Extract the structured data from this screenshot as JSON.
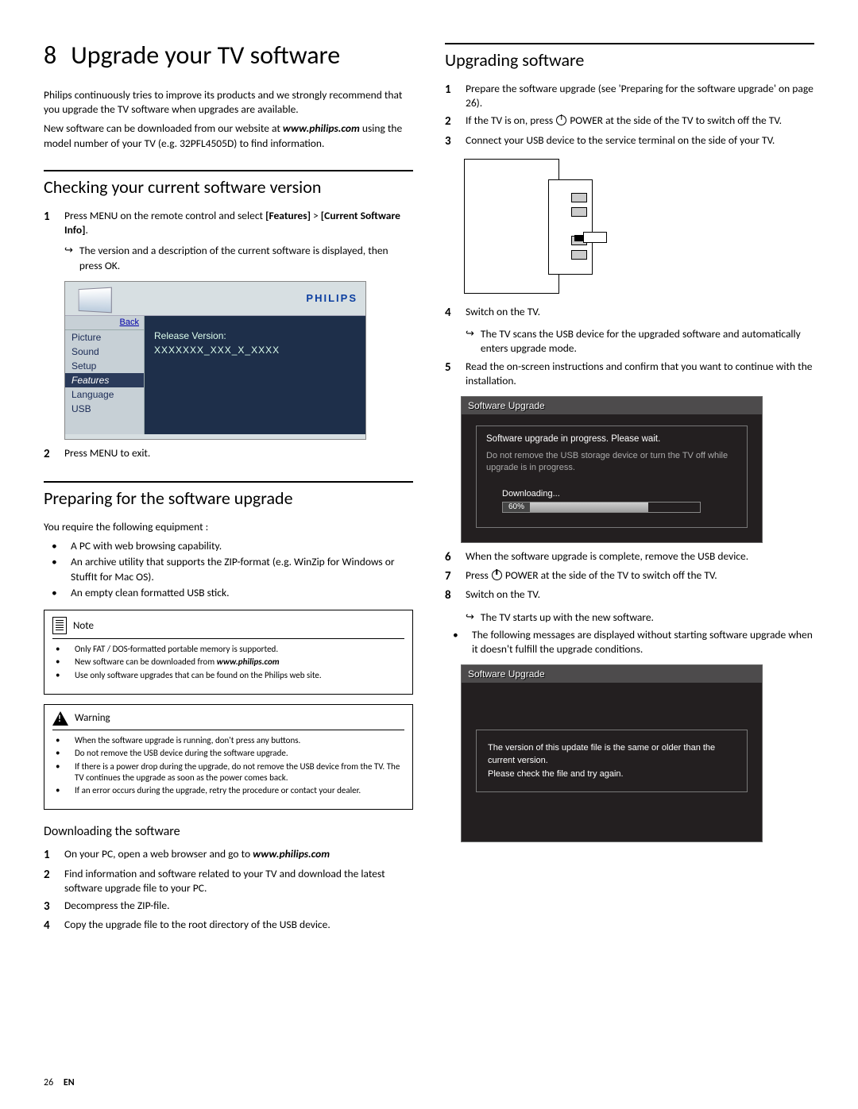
{
  "chapter": {
    "number": "8",
    "title": "Upgrade your TV software"
  },
  "intro1": "Philips continuously tries to improve its products and we strongly recommend that you upgrade the TV software when upgrades are available.",
  "intro2a": "New software can be downloaded from our website at ",
  "intro2_site": "www.philips.com",
  "intro2b": " using the model number of your TV (e.g. 32PFL4505D) to find information.",
  "section_check": "Checking your current software version",
  "check_step1a": "Press MENU on the remote control and select ",
  "check_step1b": "[Features]",
  "check_step1c": " > ",
  "check_step1d": "[Current Software Info]",
  "check_step1e": ".",
  "check_sub1": "The version and a description of the current software is displayed, then press OK.",
  "tv_logo": "PHILIPS",
  "tv_back": "Back",
  "tv_menu": [
    "Picture",
    "Sound",
    "Setup",
    "Features",
    "Language",
    "USB"
  ],
  "tv_release1": "Release Version:",
  "tv_release2": "XXXXXXX_XXX_X_XXXX",
  "check_step2": "Press MENU to exit.",
  "section_prepare": "Preparing for the software upgrade",
  "prepare_intro": "You require the following equipment :",
  "prepare_bullets": [
    "A PC with web browsing capability.",
    "An archive utility that supports the ZIP-format (e.g. WinZip for Windows or StuffIt for Mac OS).",
    "An empty clean formatted USB stick."
  ],
  "note_label": "Note",
  "note_items_a": "Only FAT / DOS-formatted portable memory is supported.",
  "note_items_b_pre": "New software can be downloaded from ",
  "note_items_b_site": "www.philips.com",
  "note_items_c": "Use only software upgrades that can be found on the Philips web site.",
  "warn_label": "Warning",
  "warn_items": [
    "When the software upgrade is running, don't press any buttons.",
    "Do not remove the USB device during the software upgrade.",
    "If there is a power drop during the upgrade, do not remove the USB device from the TV. The TV continues the upgrade as soon as the power comes back.",
    "If an error occurs during the upgrade, retry the procedure or contact your dealer."
  ],
  "subsection_download": "Downloading the software",
  "dl_step1a": "On your PC, open a web browser and go to ",
  "dl_step1_site": "www.philips.com",
  "dl_step2": "Find information and software related to your TV and download the latest software upgrade file to your PC.",
  "dl_step3": "Decompress the ZIP-file.",
  "dl_step4": "Copy the upgrade file to the root directory of the USB device.",
  "section_upgrade": "Upgrading software",
  "up_step1": "Prepare the software upgrade (see 'Preparing for the software upgrade' on page 26).",
  "up_step2a": "If the TV is on, press ",
  "up_step2b": " POWER at the side of the TV to switch off the TV.",
  "up_step3": "Connect your USB device to the service terminal on the side of your TV.",
  "up_step4": "Switch on the TV.",
  "up_sub4": "The TV scans the USB device for the upgraded software and automatically enters upgrade mode.",
  "up_step5": "Read the on-screen instructions and confirm that you want to continue with the installation.",
  "su_title": "Software Upgrade",
  "su_progress_line1": "Software upgrade in progress. Please wait.",
  "su_progress_line2": "Do not remove the USB storage device or turn the TV off while upgrade is in progress.",
  "su_downloading": "Downloading...",
  "su_percent": "60%",
  "up_step6": "When the software upgrade is complete, remove the USB device.",
  "up_step7a": "Press ",
  "up_step7b": " POWER at the side of the TV to switch off the TV.",
  "up_step8": "Switch on the TV.",
  "up_sub8": "The TV starts up with the new software.",
  "up_tail": "The following messages are displayed without starting software upgrade when it doesn't fulfill the upgrade conditions.",
  "su_msg1": "The version of this update file is the same or older than the current version.",
  "su_msg2": "Please check the file and try again.",
  "footer_page": "26",
  "footer_lang": "EN"
}
